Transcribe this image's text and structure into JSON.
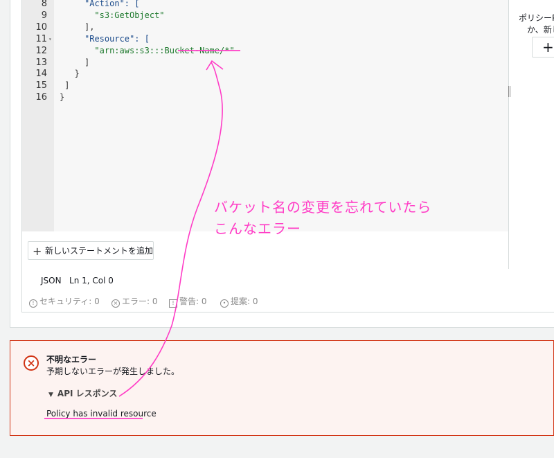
{
  "editor": {
    "lines": [
      {
        "num": "8",
        "text": "\"Action\": [",
        "kind": "key",
        "indent": 5
      },
      {
        "num": "9",
        "text": "\"s3:GetObject\"",
        "kind": "str",
        "indent": 7
      },
      {
        "num": "10",
        "text": "],",
        "kind": "punc",
        "indent": 5
      },
      {
        "num": "11",
        "text": "\"Resource\": [",
        "kind": "key",
        "indent": 5,
        "fold": true
      },
      {
        "num": "12",
        "text": "\"arn:aws:s3:::Bucket-Name/*\"",
        "kind": "str",
        "indent": 7
      },
      {
        "num": "13",
        "text": "]",
        "kind": "punc",
        "indent": 5
      },
      {
        "num": "14",
        "text": "}",
        "kind": "punc",
        "indent": 3
      },
      {
        "num": "15",
        "text": "]",
        "kind": "punc",
        "indent": 1
      },
      {
        "num": "16",
        "text": "}",
        "kind": "punc",
        "indent": 0
      }
    ],
    "add_statement_label": "新しいステートメントを追加",
    "status": {
      "mode": "JSON",
      "position": "Ln 1, Col 0"
    },
    "diagnostics": {
      "security": "セキュリティ: 0",
      "errors": "エラー: 0",
      "warnings": "警告: 0",
      "suggestions": "提案: 0"
    }
  },
  "right_panel": {
    "line1": "ポリシーP",
    "line2": "か、新し",
    "add_button": "+"
  },
  "alert": {
    "title": "不明なエラー",
    "message": "予期しないエラーが発生しました。",
    "api_toggle": "API レスポンス",
    "api_message": "Policy has invalid resource"
  },
  "annotation": {
    "line1": "バケット名の変更を忘れていたら",
    "line2": "こんなエラー",
    "color": "#ff3cc6"
  },
  "colors": {
    "error": "#d13212",
    "annotation": "#ff3cc6"
  }
}
